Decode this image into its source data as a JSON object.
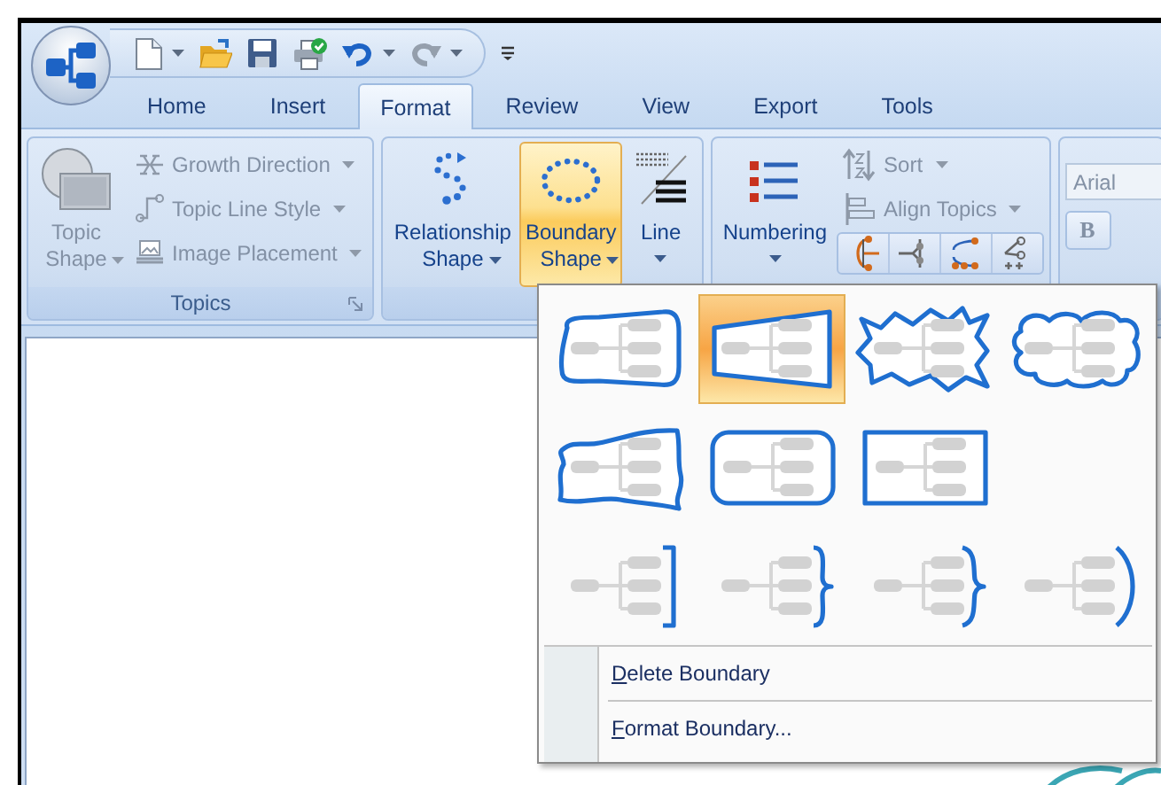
{
  "quick_access": [
    {
      "kind": "new",
      "menu": true,
      "disabled": false
    },
    {
      "kind": "open",
      "menu": false,
      "disabled": false
    },
    {
      "kind": "save",
      "menu": false,
      "disabled": false
    },
    {
      "kind": "print",
      "menu": false,
      "disabled": false
    },
    {
      "kind": "undo",
      "menu": true,
      "disabled": false
    },
    {
      "kind": "redo",
      "menu": true,
      "disabled": true
    }
  ],
  "tabs": [
    {
      "label": "Home",
      "selected": false
    },
    {
      "label": "Insert",
      "selected": false
    },
    {
      "label": "Format",
      "selected": true
    },
    {
      "label": "Review",
      "selected": false
    },
    {
      "label": "View",
      "selected": false
    },
    {
      "label": "Export",
      "selected": false
    },
    {
      "label": "Tools",
      "selected": false
    }
  ],
  "ribbon": {
    "groups": [
      {
        "title": "Topics",
        "launcher": true,
        "columns": [
          [
            {
              "kind": "large",
              "label": "Topic Shape",
              "disabled": true,
              "pressed": false
            }
          ],
          [
            {
              "kind": "small",
              "label": "Growth Direction",
              "disabled": true
            },
            {
              "kind": "small",
              "label": "Topic Line Style",
              "disabled": true
            },
            {
              "kind": "small",
              "label": "Image Placement",
              "disabled": true
            }
          ]
        ]
      },
      {
        "launcher": false,
        "columns": [
          [
            {
              "kind": "large",
              "label": "Relationship Shape",
              "disabled": false,
              "pressed": false
            }
          ],
          [
            {
              "kind": "large",
              "label": "Boundary Shape",
              "disabled": false,
              "pressed": true
            }
          ],
          [
            {
              "kind": "large",
              "label": "Line",
              "disabled": false,
              "pressed": false
            }
          ]
        ]
      },
      {
        "launcher": false,
        "columns": [
          [
            {
              "kind": "large",
              "label": "Numbering",
              "disabled": false,
              "pressed": false
            }
          ],
          [
            {
              "kind": "small",
              "label": "Sort",
              "disabled": true
            },
            {
              "kind": "small",
              "label": "Align Topics",
              "disabled": true
            },
            {
              "kind": "iconrow"
            }
          ]
        ]
      },
      {
        "launcher": false,
        "columns": [
          [
            {
              "kind": "field",
              "value": "Arial",
              "disabled": true
            },
            {
              "kind": "toggle",
              "label": "B",
              "disabled": true
            }
          ]
        ]
      }
    ]
  },
  "boundary_menu": {
    "gallery": [
      [
        {
          "kind": "curved",
          "selected": false
        },
        {
          "kind": "straight",
          "selected": true
        },
        {
          "kind": "zigzag",
          "selected": false
        },
        {
          "kind": "cloud",
          "selected": false
        }
      ],
      [
        {
          "kind": "wavy",
          "selected": false
        },
        {
          "kind": "rounded",
          "selected": false
        },
        {
          "kind": "rectangle",
          "selected": false
        }
      ],
      [
        {
          "kind": "bracket",
          "selected": false
        },
        {
          "kind": "brace",
          "selected": false
        },
        {
          "kind": "smoothbrace",
          "selected": false
        },
        {
          "kind": "paren",
          "selected": false
        }
      ]
    ],
    "commands": [
      {
        "label": "Delete Boundary",
        "underline_first": true
      },
      {
        "label": "Format Boundary...",
        "underline_first": true
      }
    ]
  }
}
